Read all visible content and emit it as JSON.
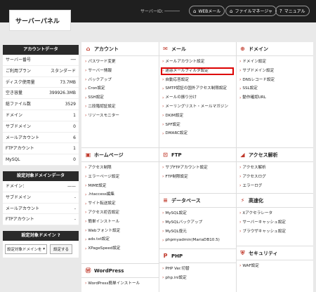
{
  "header": {
    "logo": "サーバーパネル",
    "server_id": "サーバーID: ──────",
    "buttons": [
      {
        "icon": "⌂",
        "label": "WEBメール"
      },
      {
        "icon": "⌂",
        "label": "ファイルマネージャ"
      },
      {
        "icon": "?",
        "label": "マニュアル"
      }
    ]
  },
  "sidebar": {
    "account": {
      "title": "アカウントデータ",
      "rows": [
        {
          "label": "サーバー番号",
          "value": "──"
        },
        {
          "label": "ご利用プラン",
          "value": "スタンダード"
        },
        {
          "label": "ディスク使用量",
          "value": "73.7MB"
        },
        {
          "label": "空き容量",
          "value": "399926.3MB"
        },
        {
          "label": "総ファイル数",
          "value": "3529"
        },
        {
          "label": "ドメイン",
          "value": "1"
        },
        {
          "label": "サブドメイン",
          "value": "0"
        },
        {
          "label": "メールアカウント",
          "value": "6"
        },
        {
          "label": "FTPアカウント",
          "value": "1"
        },
        {
          "label": "MySQL",
          "value": "0"
        }
      ]
    },
    "domain_data": {
      "title": "設定対象ドメインデータ",
      "rows": [
        {
          "label": "ドメイン：",
          "value": "——"
        },
        {
          "label": "サブドメイン",
          "value": "-"
        },
        {
          "label": "メールアカウント",
          "value": "-"
        },
        {
          "label": "FTPアカウント",
          "value": "-"
        }
      ]
    },
    "target_domain": {
      "title": "設定対象ドメイン",
      "select_value": "設定対象ドメインを",
      "button": "設定する"
    }
  },
  "panels": {
    "account": {
      "title": "アカウント",
      "icon": "⌂",
      "items": [
        "パスワード変更",
        "サーバー情報",
        "バックアップ",
        "Cron設定",
        "SSH設定",
        "二段階認証設定",
        "リソースモニター"
      ]
    },
    "mail": {
      "title": "メール",
      "icon": "✉",
      "items": [
        "メールアカウント設定",
        "迷惑メールフィルタ設定",
        "自動応答設定",
        "SMTP認証の国外アクセス制限設定",
        "メールの振り分け",
        "メーリングリスト・メールマガジン",
        "DKIM設定",
        "SPF設定",
        "DMARC設定"
      ]
    },
    "domain": {
      "title": "ドメイン",
      "icon": "⊕",
      "items": [
        "ドメイン設定",
        "サブドメイン設定",
        "DNSレコード設定",
        "SSL設定",
        "動作確認URL"
      ]
    },
    "homepage": {
      "title": "ホームページ",
      "icon": "▣",
      "items": [
        "アクセス制限",
        "エラーページ設定",
        "MIME設定",
        ".htaccess編集",
        "サイト転送設定",
        "アクセス拒否設定",
        "簡単インストール",
        "Webフォント設定",
        "ads.txt設定",
        "XPageSpeed設定"
      ]
    },
    "ftp": {
      "title": "FTP",
      "icon": "⊡",
      "items": [
        "サブFTPアカウント設定",
        "FTP制限設定"
      ]
    },
    "access": {
      "title": "アクセス解析",
      "icon": "◢",
      "items": [
        "アクセス解析",
        "アクセスログ",
        "エラーログ"
      ]
    },
    "database": {
      "title": "データベース",
      "icon": "≡",
      "items": [
        "MySQL設定",
        "MySQLバックアップ",
        "MySQL復元",
        "phpmyadmin(MariaDB10.5)"
      ]
    },
    "speed": {
      "title": "高速化",
      "icon": "⚡",
      "items": [
        "Xアクセラレータ",
        "サーバーキャッシュ設定",
        "ブラウザキャッシュ設定"
      ]
    },
    "wordpress": {
      "title": "WordPress",
      "icon": "Ⓦ",
      "items": [
        "WordPress簡単インストール"
      ]
    },
    "php": {
      "title": "PHP",
      "icon": "P",
      "items": [
        "PHP Ver.切替",
        "php.ini設定"
      ]
    },
    "security": {
      "title": "セキュリティ",
      "icon": "⛨",
      "items": [
        "WAF設定"
      ]
    }
  },
  "highlighted_item": "迷惑メールフィルタ設定",
  "colors": {
    "accent": "#c0392b",
    "highlight": "#dd0000",
    "topbar": "#1f1f1f"
  }
}
